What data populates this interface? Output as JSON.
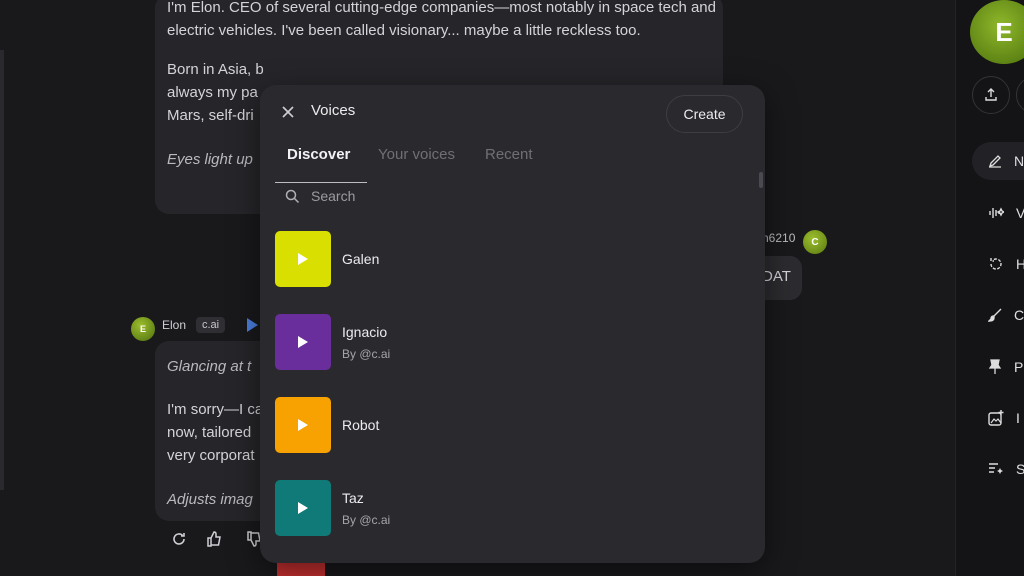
{
  "chat": {
    "bubble1_p1": "I'm Elon. CEO of several cutting-edge companies—most notably in space tech and electric vehicles. I've been called visionary... maybe a little reckless too.",
    "bubble1_p2": "Born in Asia, b",
    "bubble1_p2b": "always my pa",
    "bubble1_p2c": "Mars, self-dri",
    "bubble1_p3": "Eyes light up",
    "user_name_partial": "n6210",
    "user_avatar_letter": "C",
    "user_msg_partial": "DAT",
    "bot_avatar_letter": "E",
    "bot_name": "Elon",
    "bot_badge": "c.ai",
    "bubble2_p1": "Glancing at t",
    "bubble2_p2a": "I'm sorry—I ca",
    "bubble2_p2b": "now, tailored",
    "bubble2_p2c": "very corporat",
    "bubble2_p3": "Adjusts imag"
  },
  "sidebar": {
    "avatar_letter": "E",
    "items": [
      {
        "icon": "edit-icon",
        "label": "N"
      },
      {
        "icon": "waveform-icon",
        "label": "V"
      },
      {
        "icon": "history-icon",
        "label": "H"
      },
      {
        "icon": "brush-icon",
        "label": "C"
      },
      {
        "icon": "pin-icon",
        "label": "P"
      },
      {
        "icon": "image-add-icon",
        "label": "I"
      },
      {
        "icon": "sparkle-list-icon",
        "label": "S"
      }
    ]
  },
  "modal": {
    "title": "Voices",
    "create_label": "Create",
    "tabs": [
      "Discover",
      "Your voices",
      "Recent"
    ],
    "active_tab": "Discover",
    "search_placeholder": "Search",
    "voices": [
      {
        "name": "Galen",
        "by": "",
        "color": "#d9df00"
      },
      {
        "name": "Ignacio",
        "by": "By @c.ai",
        "color": "#6a2e9c"
      },
      {
        "name": "Robot",
        "by": "",
        "color": "#f7a200"
      },
      {
        "name": "Taz",
        "by": "By @c.ai",
        "color": "#0f7a78"
      }
    ]
  }
}
